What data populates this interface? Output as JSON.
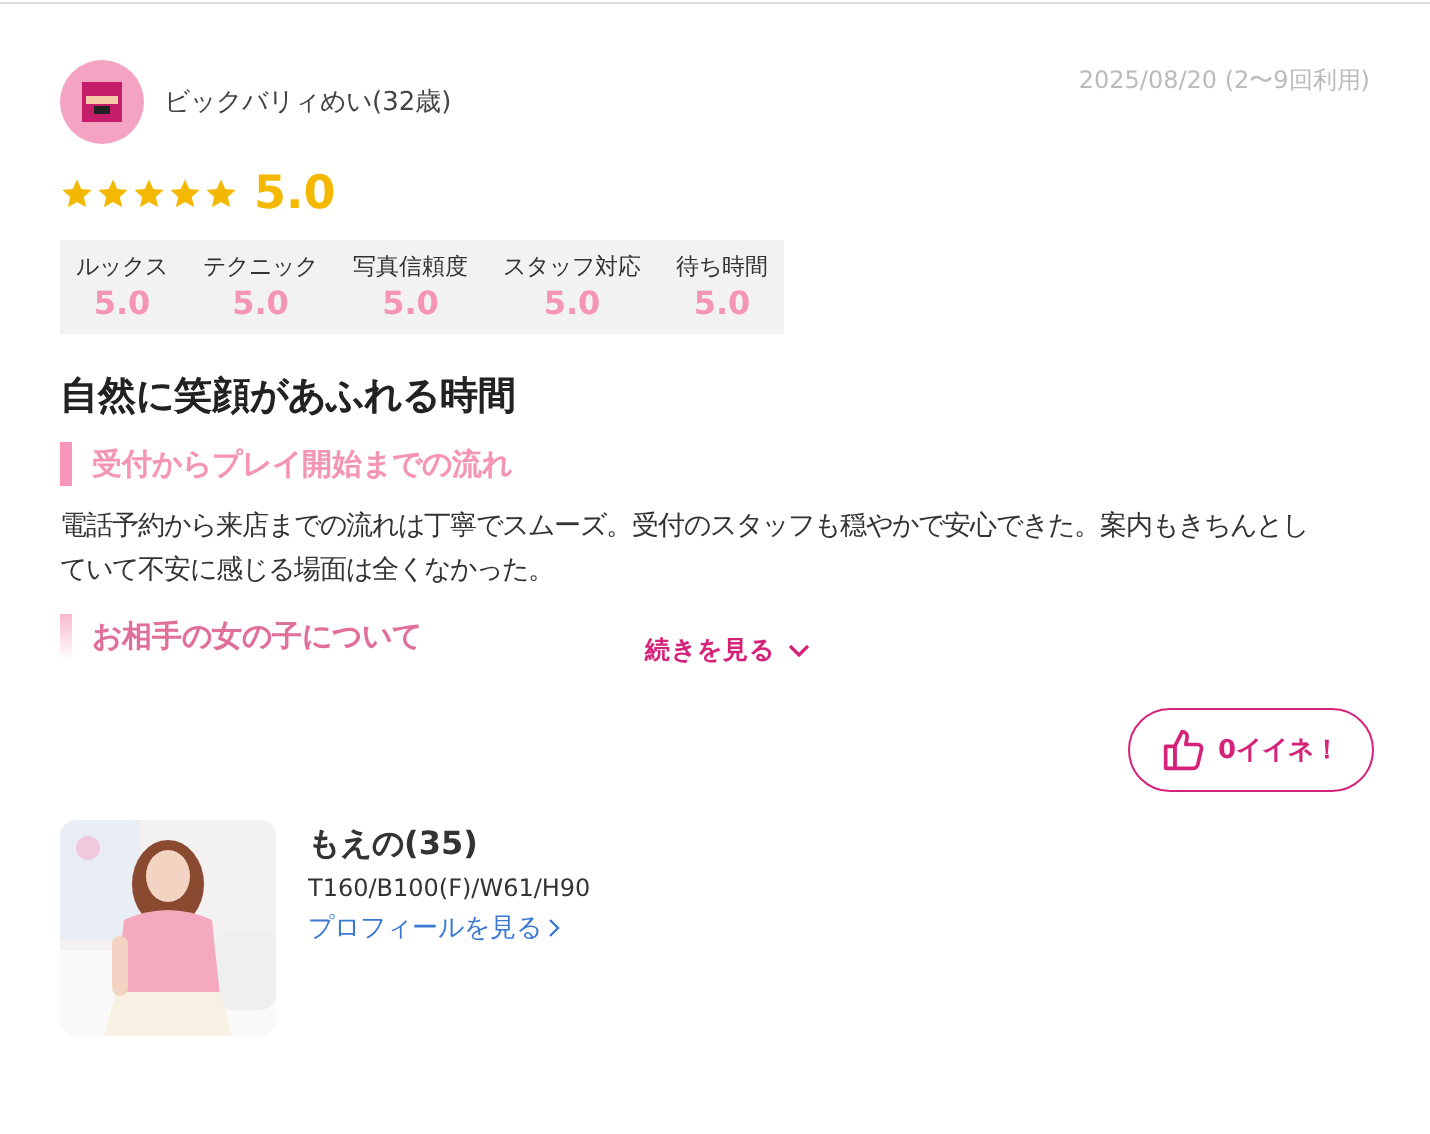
{
  "reviewer": {
    "name": "ビックバリィめい(32歳)",
    "date": "2025/08/20 (2〜9回利用)"
  },
  "overall": {
    "stars": 5,
    "score": "5.0"
  },
  "ratings": [
    {
      "label": "ルックス",
      "value": "5.0"
    },
    {
      "label": "テクニック",
      "value": "5.0"
    },
    {
      "label": "写真信頼度",
      "value": "5.0"
    },
    {
      "label": "スタッフ対応",
      "value": "5.0"
    },
    {
      "label": "待ち時間",
      "value": "5.0"
    }
  ],
  "review": {
    "title": "自然に笑顔があふれる時間",
    "collapsed": true,
    "sections": [
      {
        "heading": "受付からプレイ開始までの流れ",
        "body": "電話予約から来店までの流れは丁寧でスムーズ。受付のスタッフも穏やかで安心できた。案内もきちんとしていて不安に感じる場面は全くなかった。"
      },
      {
        "heading": "お相手の女の子について"
      }
    ],
    "more_link": "続きを見る"
  },
  "like_button": {
    "label": "0イイネ！"
  },
  "profile": {
    "name": "もえの(35)",
    "specs": "T160/B100(F)/W61/H90",
    "link": "プロフィールを見る"
  }
}
